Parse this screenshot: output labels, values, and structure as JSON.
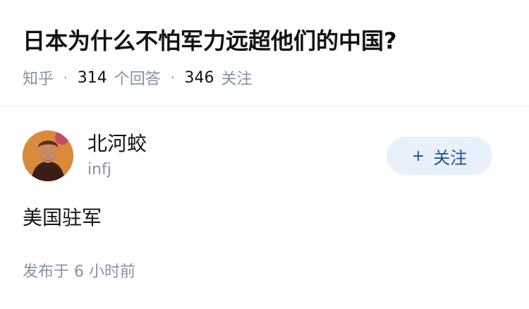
{
  "question": {
    "title": "日本为什么不怕军力远超他们的中国?",
    "source": "知乎",
    "answers_count": "314",
    "answers_label": "个回答",
    "followers_count": "346",
    "followers_label": "关注"
  },
  "answer": {
    "author_name": "北河蛟",
    "author_bio": "infj",
    "follow_button_label": "关注",
    "follow_button_icon": "plus-icon",
    "content": "美国驻军",
    "publish_time": "发布于 6 小时前"
  },
  "colors": {
    "meta_gray": "#8590a6",
    "follow_bg": "#e8f1fb",
    "follow_text": "#175199",
    "text": "#121212"
  }
}
